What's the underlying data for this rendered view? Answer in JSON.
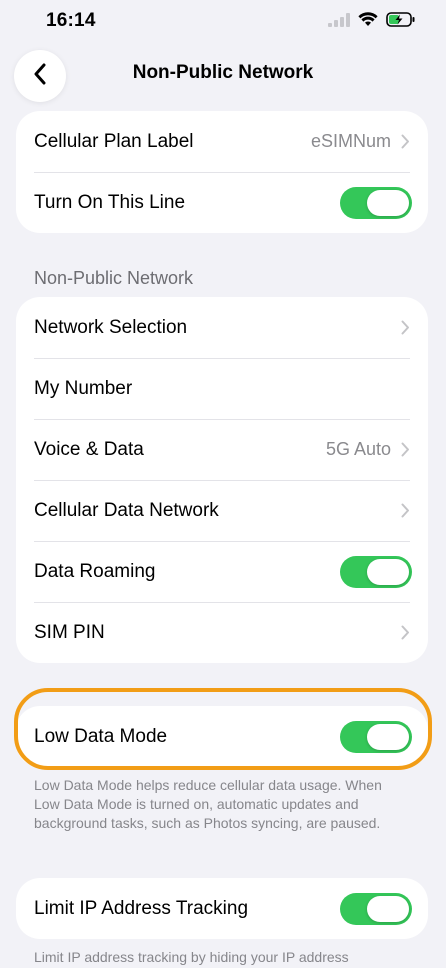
{
  "status": {
    "time": "16:14"
  },
  "nav": {
    "title": "Non-Public Network"
  },
  "group1": {
    "plan_label": {
      "label": "Cellular Plan Label",
      "value": "eSIMNum"
    },
    "turn_on": {
      "label": "Turn On This Line",
      "on": true
    }
  },
  "section": {
    "header": "Non-Public Network"
  },
  "group2": {
    "network_selection": {
      "label": "Network Selection"
    },
    "my_number": {
      "label": "My Number"
    },
    "voice_data": {
      "label": "Voice & Data",
      "value": "5G Auto"
    },
    "cellular_data_network": {
      "label": "Cellular Data Network"
    },
    "data_roaming": {
      "label": "Data Roaming",
      "on": true
    },
    "sim_pin": {
      "label": "SIM PIN"
    }
  },
  "low_data": {
    "label": "Low Data Mode",
    "on": true,
    "footnote": "Low Data Mode helps reduce cellular data usage. When Low Data Mode is turned on, automatic updates and background tasks, such as Photos syncing, are paused."
  },
  "limit_ip": {
    "label": "Limit IP Address Tracking",
    "on": true,
    "footnote": "Limit IP address tracking by hiding your IP address"
  },
  "colors": {
    "toggle_on": "#34c759",
    "highlight": "#f29d16",
    "background": "#f2f2f7"
  }
}
